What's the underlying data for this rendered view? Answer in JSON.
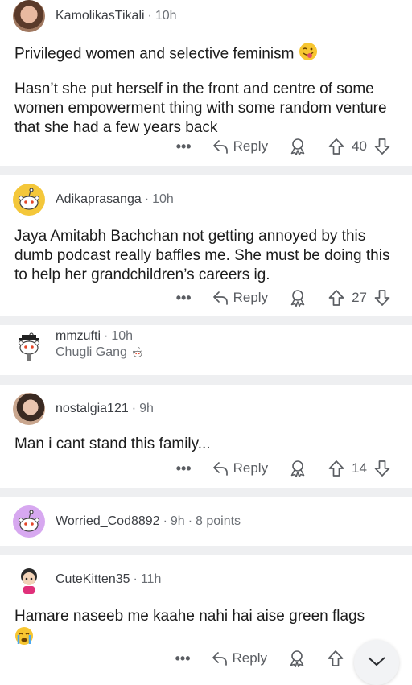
{
  "colors": {
    "separator": "#eeeff1",
    "username": "#3c3f44",
    "meta": "#6b6f75",
    "text": "#1c1c1c",
    "icon": "#5a5d62"
  },
  "comments": [
    {
      "username": "KamolikasTikali",
      "age": "10h",
      "paragraphs": [
        "Privileged women and selective feminism",
        "Hasn’t she put herself in the front and centre of some women empowerment thing with some random venture that she had a few years back"
      ],
      "reply_label": "Reply",
      "score": "40",
      "emoji": "tongue-face-emoji"
    },
    {
      "username": "Adikaprasanga",
      "age": "10h",
      "paragraphs": [
        "Jaya Amitabh Bachchan not getting annoyed by this dumb podcast really baffles me. She must be doing this to help her grandchildren’s careers ig."
      ],
      "reply_label": "Reply",
      "score": "27"
    },
    {
      "username": "mmzufti",
      "age": "10h",
      "flair": "Chugli Gang",
      "collapsed": true
    },
    {
      "username": "nostalgia121",
      "age": "9h",
      "paragraphs": [
        "Man i cant stand this family..."
      ],
      "reply_label": "Reply",
      "score": "14"
    },
    {
      "username": "Worried_Cod8892",
      "age": "9h",
      "points": "8 points",
      "collapsed": true
    },
    {
      "username": "CuteKitten35",
      "age": "11h",
      "paragraphs": [
        "Hamare naseeb me kaahe nahi hai aise green flags"
      ],
      "reply_label": "Reply",
      "emoji": "crying-face-emoji"
    }
  ],
  "icons": {
    "more": "more-options-icon",
    "reply": "reply-arrow-icon",
    "award": "award-icon",
    "upvote": "upvote-icon",
    "downvote": "downvote-icon",
    "scroll": "chevron-down-icon"
  }
}
